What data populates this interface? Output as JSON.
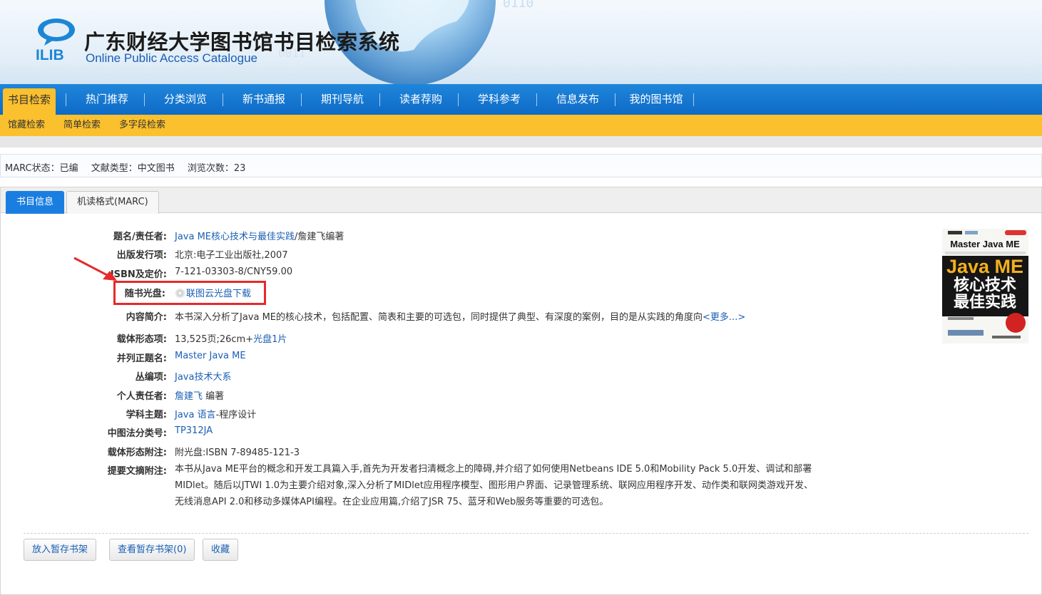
{
  "header": {
    "logo_text": "ILIB",
    "title": "广东财经大学图书馆书目检索系统",
    "subtitle": "Online Public Access Catalogue"
  },
  "main_nav": [
    "书目检索",
    "热门推荐",
    "分类浏览",
    "新书通报",
    "期刊导航",
    "读者荐购",
    "学科参考",
    "信息发布",
    "我的图书馆"
  ],
  "sub_nav": [
    "馆藏检索",
    "简单检索",
    "多字段检索"
  ],
  "status": {
    "marc": "MARC状态：已编",
    "doc_type": "文献类型：中文图书",
    "views": "浏览次数：23"
  },
  "tabs": [
    "书目信息",
    "机读格式(MARC)"
  ],
  "details": {
    "title_label": "题名/责任者:",
    "title_link": "Java ME核心技术与最佳实践",
    "title_rest": "/詹建飞编著",
    "pub_label": "出版发行项:",
    "pub_value": "北京:电子工业出版社,2007",
    "isbn_label": "ISBN及定价:",
    "isbn_value": "7-121-03303-8/CNY59.00",
    "cd_label": "随书光盘:",
    "cd_link": "联图云光盘下载",
    "summary_label": "内容简介:",
    "summary_value": "本书深入分析了Java ME的核心技术，包括配置、简表和主要的可选包，同时提供了典型、有深度的案例，目的是从实践的角度向",
    "summary_more": "<更多...>",
    "form_label": "载体形态项:",
    "form_value": "13,525页;26cm+",
    "form_link": "光盘1片",
    "parallel_label": "并列正题名:",
    "parallel_value": "Master Java ME",
    "series_label": "丛编项:",
    "series_value": "Java技术大系",
    "author_label": "个人责任者:",
    "author_link": "詹建飞",
    "author_rest": " 编著",
    "subject_label": "学科主题:",
    "subject_link": "Java 语言",
    "subject_rest": "-程序设计",
    "clc_label": "中图法分类号:",
    "clc_value": "TP312JA",
    "form_note_label": "载体形态附注:",
    "form_note_value": "附光盘:ISBN 7-89485-121-3",
    "abstract_label": "提要文摘附注:",
    "abstract_value": "本书从Java ME平台的概念和开发工具篇入手,首先为开发者扫清概念上的障碍,并介绍了如何使用Netbeans IDE 5.0和Mobility Pack 5.0开发、调试和部署MIDlet。随后以JTWI 1.0为主要介绍对象,深入分析了MIDlet应用程序模型、图形用户界面、记录管理系统、联网应用程序开发、动作类和联网类游戏开发、无线消息API 2.0和移动多媒体API编程。在企业应用篇,介绍了JSR 75、蓝牙和Web服务等重要的可选包。"
  },
  "cover": {
    "top_text": "Master Java ME",
    "big_text_1": "Java ME",
    "big_text_2": "核心技术",
    "big_text_3": "最佳实践"
  },
  "buttons": [
    "放入暂存书架",
    "查看暂存书架(0)",
    "收藏"
  ],
  "colors": {
    "nav_blue": "#0e6ac6",
    "sub_nav_yellow": "#fbc02d",
    "link_blue": "#1a5fb5",
    "highlight_red": "#e62a2a"
  }
}
